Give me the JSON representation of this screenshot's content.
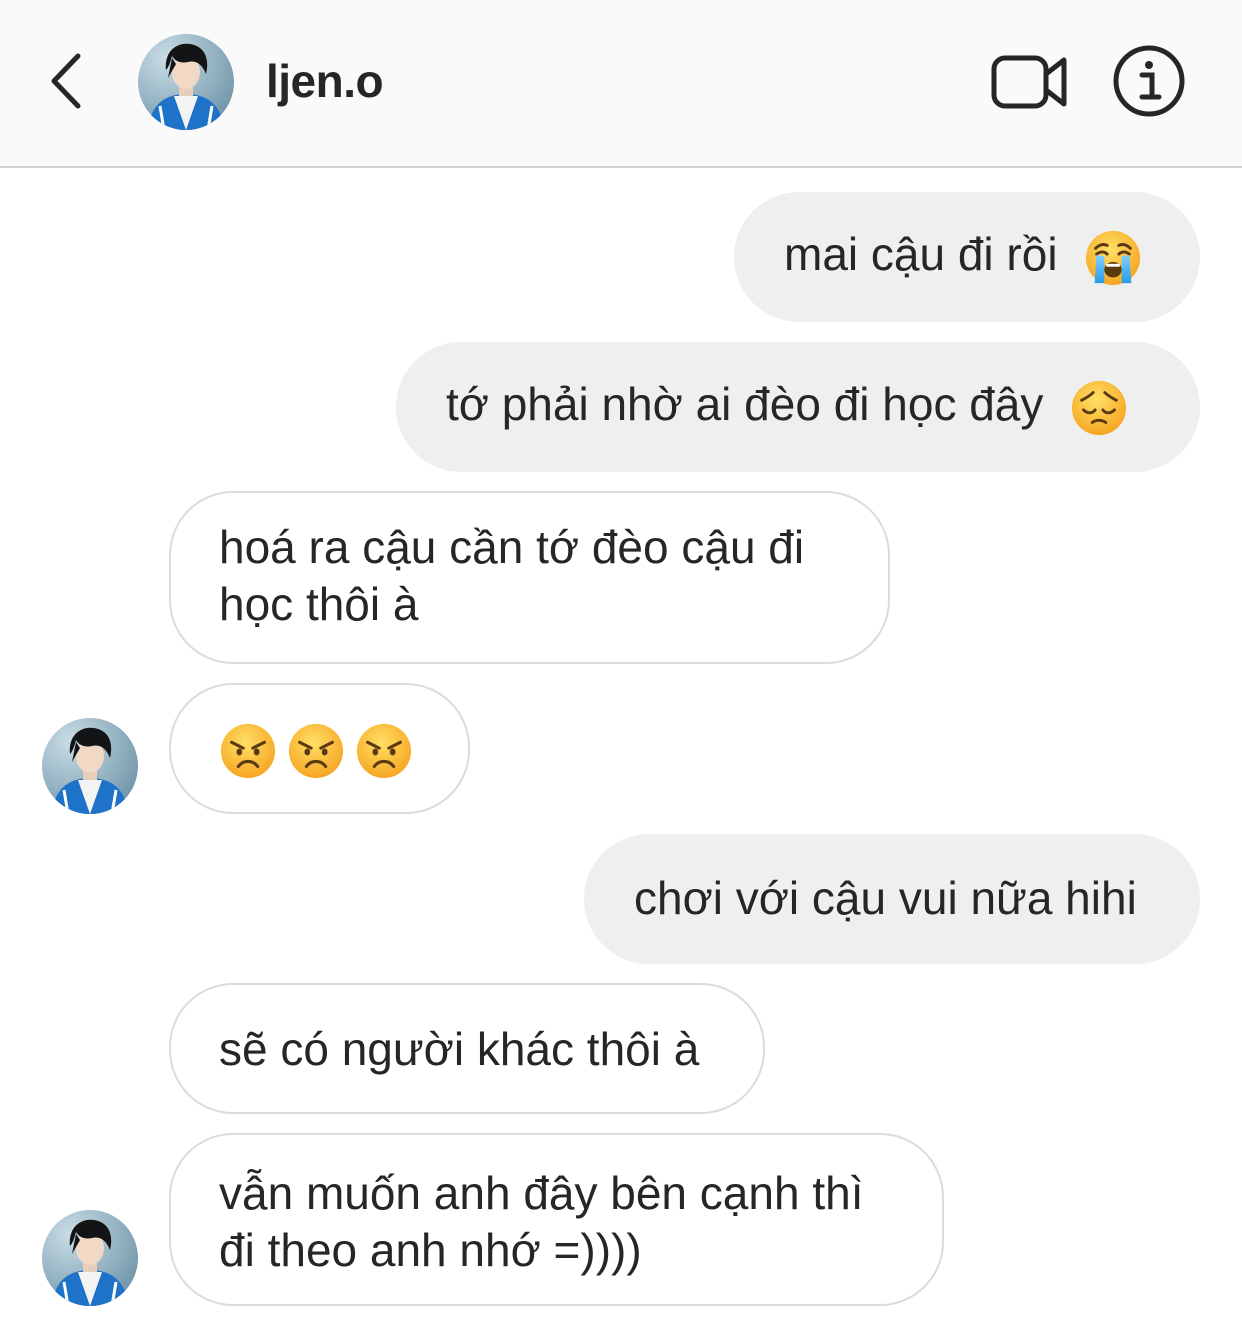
{
  "header": {
    "username": "ljen.o",
    "icons": {
      "back": "chevron-left-icon",
      "video": "video-camera-icon",
      "info": "info-icon"
    }
  },
  "messages": [
    {
      "side": "sent",
      "text": "mai cậu đi rồi",
      "emoji": [
        "loudly-crying-face"
      ]
    },
    {
      "side": "sent",
      "text": "tớ phải nhờ ai đèo đi học đây",
      "emoji": [
        "pensive-face"
      ]
    },
    {
      "side": "received",
      "text": "hoá ra cậu cần tớ đèo cậu đi học thôi à"
    },
    {
      "side": "received",
      "text": "",
      "emoji": [
        "angry-face",
        "angry-face",
        "angry-face"
      ]
    },
    {
      "side": "sent",
      "text": "chơi với cậu vui nữa hihi"
    },
    {
      "side": "received",
      "text": "sẽ có người khác thôi à"
    },
    {
      "side": "received",
      "text": "vẫn muốn anh đây bên cạnh thì đi theo anh nhớ =))))"
    }
  ],
  "colors": {
    "header_bg": "#fafafa",
    "sent_bubble": "#efefef",
    "received_border": "#dbdbdb",
    "text": "#262626"
  }
}
